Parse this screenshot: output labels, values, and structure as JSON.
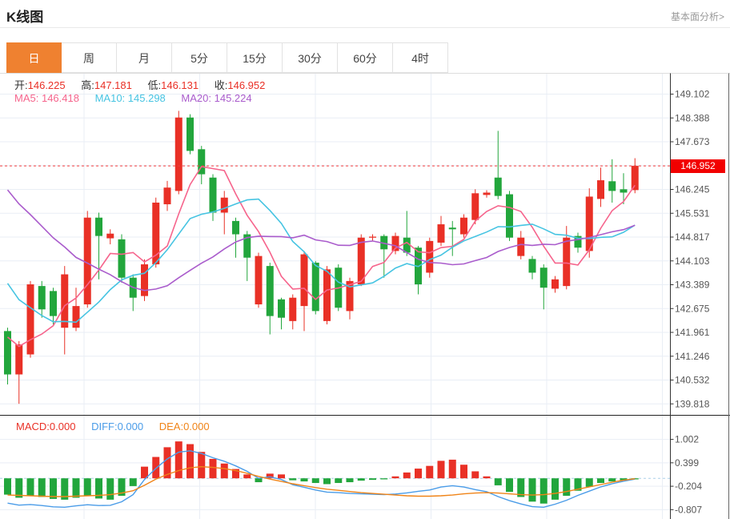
{
  "header": {
    "title": "K线图",
    "link": "基本面分析>"
  },
  "tabs": {
    "items": [
      "日",
      "周",
      "月",
      "5分",
      "15分",
      "30分",
      "60分",
      "4时"
    ],
    "selected_index": 0
  },
  "ohlc": {
    "open_label": "开:",
    "open": "146.225",
    "high_label": "高:",
    "high": "147.181",
    "low_label": "低:",
    "low": "146.131",
    "close_label": "收:",
    "close": "146.952"
  },
  "ma_info": {
    "ma5_label": "MA5:",
    "ma5": "146.418",
    "ma10_label": "MA10:",
    "ma10": "145.298",
    "ma20_label": "MA20:",
    "ma20": "145.224"
  },
  "macd_info": {
    "macd_label": "MACD:",
    "macd": "0.000",
    "diff_label": "DIFF:",
    "diff": "0.000",
    "dea_label": "DEA:",
    "dea": "0.000"
  },
  "price_tag": "146.952",
  "colors": {
    "up": "#e93026",
    "down": "#22a63c",
    "ma5": "#f6648c",
    "ma10": "#46c4e2",
    "ma20": "#aa5ccc",
    "diff_line": "#4a9ce8",
    "dea_line": "#f08418",
    "dotted_price_line": "#f23c3c",
    "tag_bg": "#f20000",
    "zero_dash": "#abd0e9",
    "grid": "#e9eef5",
    "axis": "#333333",
    "tick_text": "#555555",
    "label_text": "#333333",
    "value_red": "#e93026",
    "tab_active_bg": "#ef8130"
  },
  "chart_data": {
    "type": "candlestick+macd",
    "title": "K线图",
    "legend": [
      "MA5",
      "MA10",
      "MA20",
      "MACD",
      "DIFF",
      "DEA"
    ],
    "main": {
      "y_ticks": [
        "149.102",
        "148.388",
        "147.673",
        "146.952",
        "146.245",
        "145.531",
        "144.817",
        "144.103",
        "143.389",
        "142.675",
        "141.961",
        "141.246",
        "140.532",
        "139.818"
      ],
      "ylim": [
        139.818,
        149.102
      ],
      "current_price": 146.952,
      "ma_periods": [
        5,
        10,
        20
      ],
      "ma_seed_closes": [
        150.0,
        149.8,
        149.6,
        149.4,
        149.2,
        149.0,
        148.8,
        148.5,
        148.2,
        147.8,
        146.5,
        145.8,
        145.0,
        144.3,
        143.6,
        143.0,
        142.4,
        141.8,
        141.2
      ],
      "candles_format": [
        "open",
        "high",
        "low",
        "close"
      ],
      "candles": [
        [
          142.0,
          142.1,
          140.4,
          140.7
        ],
        [
          140.7,
          141.7,
          139.82,
          141.6
        ],
        [
          141.3,
          143.5,
          141.2,
          143.4
        ],
        [
          143.35,
          143.5,
          142.4,
          142.65
        ],
        [
          143.2,
          143.3,
          142.2,
          142.45
        ],
        [
          142.1,
          143.95,
          141.3,
          143.7
        ],
        [
          142.1,
          143.3,
          142.0,
          142.75
        ],
        [
          142.8,
          145.6,
          142.7,
          145.4
        ],
        [
          145.4,
          145.55,
          143.55,
          144.85
        ],
        [
          144.78,
          145.05,
          144.6,
          144.92
        ],
        [
          144.75,
          144.9,
          143.45,
          143.6
        ],
        [
          143.6,
          143.7,
          142.6,
          143.0
        ],
        [
          143.05,
          144.15,
          142.9,
          144.0
        ],
        [
          144.0,
          146.0,
          143.9,
          145.85
        ],
        [
          145.8,
          146.5,
          145.6,
          146.3
        ],
        [
          146.2,
          148.6,
          146.1,
          148.4
        ],
        [
          148.4,
          148.5,
          147.3,
          147.4
        ],
        [
          147.45,
          147.55,
          146.4,
          146.7
        ],
        [
          146.6,
          146.7,
          145.3,
          145.55
        ],
        [
          145.55,
          146.2,
          144.9,
          146.0
        ],
        [
          145.3,
          145.4,
          144.2,
          144.9
        ],
        [
          144.9,
          145.0,
          143.5,
          144.2
        ],
        [
          142.8,
          144.35,
          142.7,
          144.25
        ],
        [
          143.95,
          144.05,
          141.9,
          142.45
        ],
        [
          142.95,
          143.0,
          142.05,
          142.4
        ],
        [
          142.3,
          143.1,
          142.05,
          143.0
        ],
        [
          142.75,
          144.4,
          142.0,
          144.3
        ],
        [
          144.05,
          144.1,
          142.5,
          142.6
        ],
        [
          142.3,
          143.95,
          142.2,
          143.85
        ],
        [
          143.9,
          144.0,
          142.6,
          142.7
        ],
        [
          142.6,
          143.6,
          142.35,
          143.5
        ],
        [
          143.4,
          144.9,
          143.35,
          144.8
        ],
        [
          144.8,
          144.9,
          144.7,
          144.83
        ],
        [
          144.85,
          144.9,
          143.6,
          144.45
        ],
        [
          144.4,
          144.95,
          144.3,
          144.85
        ],
        [
          144.8,
          145.6,
          144.25,
          144.35
        ],
        [
          144.5,
          144.55,
          143.1,
          143.4
        ],
        [
          143.75,
          144.8,
          143.6,
          144.7
        ],
        [
          144.65,
          145.45,
          144.55,
          145.2
        ],
        [
          145.1,
          145.3,
          144.25,
          145.05
        ],
        [
          144.9,
          145.5,
          144.8,
          145.4
        ],
        [
          145.33,
          146.25,
          145.2,
          146.13
        ],
        [
          146.08,
          146.22,
          146.0,
          146.15
        ],
        [
          146.6,
          148.0,
          145.95,
          146.05
        ],
        [
          146.1,
          146.2,
          144.7,
          144.8
        ],
        [
          144.25,
          145.0,
          144.15,
          144.8
        ],
        [
          144.16,
          144.25,
          143.55,
          143.75
        ],
        [
          143.9,
          144.0,
          142.65,
          143.3
        ],
        [
          143.27,
          143.65,
          143.15,
          143.55
        ],
        [
          143.35,
          145.15,
          143.25,
          144.8
        ],
        [
          144.85,
          144.95,
          144.35,
          144.5
        ],
        [
          144.4,
          146.28,
          144.2,
          146.03
        ],
        [
          145.96,
          146.9,
          145.72,
          146.52
        ],
        [
          146.49,
          147.15,
          145.85,
          146.2
        ],
        [
          146.25,
          146.73,
          145.8,
          146.15
        ],
        [
          146.225,
          147.181,
          146.131,
          146.952
        ]
      ]
    },
    "macd": {
      "y_ticks": [
        "1.002",
        "0.399",
        "-0.204",
        "-0.807"
      ],
      "ylim": [
        -0.807,
        1.002
      ],
      "histogram": [
        -0.42,
        -0.5,
        -0.45,
        -0.48,
        -0.53,
        -0.55,
        -0.5,
        -0.46,
        -0.52,
        -0.55,
        -0.45,
        -0.2,
        0.3,
        0.55,
        0.8,
        0.95,
        0.88,
        0.68,
        0.5,
        0.38,
        0.24,
        0.1,
        -0.1,
        0.12,
        0.1,
        -0.05,
        -0.08,
        -0.12,
        -0.15,
        -0.12,
        -0.1,
        -0.06,
        -0.04,
        -0.02,
        0.05,
        0.15,
        0.25,
        0.32,
        0.45,
        0.48,
        0.35,
        0.18,
        0.05,
        -0.18,
        -0.35,
        -0.48,
        -0.6,
        -0.65,
        -0.55,
        -0.45,
        -0.32,
        -0.22,
        -0.12,
        -0.08,
        -0.05,
        -0.02
      ],
      "diff": [
        -0.64,
        -0.69,
        -0.675,
        -0.7,
        -0.735,
        -0.745,
        -0.71,
        -0.68,
        -0.7,
        -0.695,
        -0.605,
        -0.42,
        -0.03,
        0.255,
        0.5,
        0.675,
        0.71,
        0.64,
        0.53,
        0.44,
        0.32,
        0.18,
        0.0,
        0.04,
        -0.03,
        -0.165,
        -0.23,
        -0.3,
        -0.355,
        -0.37,
        -0.39,
        -0.4,
        -0.41,
        -0.42,
        -0.405,
        -0.375,
        -0.335,
        -0.3,
        -0.225,
        -0.19,
        -0.225,
        -0.29,
        -0.345,
        -0.47,
        -0.575,
        -0.66,
        -0.73,
        -0.745,
        -0.665,
        -0.565,
        -0.44,
        -0.33,
        -0.22,
        -0.14,
        -0.075,
        -0.02
      ],
      "dea": [
        -0.43,
        -0.44,
        -0.45,
        -0.46,
        -0.47,
        -0.47,
        -0.46,
        -0.45,
        -0.44,
        -0.42,
        -0.38,
        -0.32,
        -0.18,
        -0.02,
        0.1,
        0.2,
        0.27,
        0.3,
        0.28,
        0.25,
        0.2,
        0.13,
        0.05,
        -0.02,
        -0.08,
        -0.14,
        -0.19,
        -0.24,
        -0.28,
        -0.31,
        -0.34,
        -0.37,
        -0.39,
        -0.41,
        -0.43,
        -0.45,
        -0.46,
        -0.46,
        -0.45,
        -0.43,
        -0.4,
        -0.38,
        -0.37,
        -0.38,
        -0.4,
        -0.42,
        -0.43,
        -0.42,
        -0.39,
        -0.34,
        -0.28,
        -0.22,
        -0.16,
        -0.1,
        -0.05,
        -0.01
      ]
    }
  }
}
